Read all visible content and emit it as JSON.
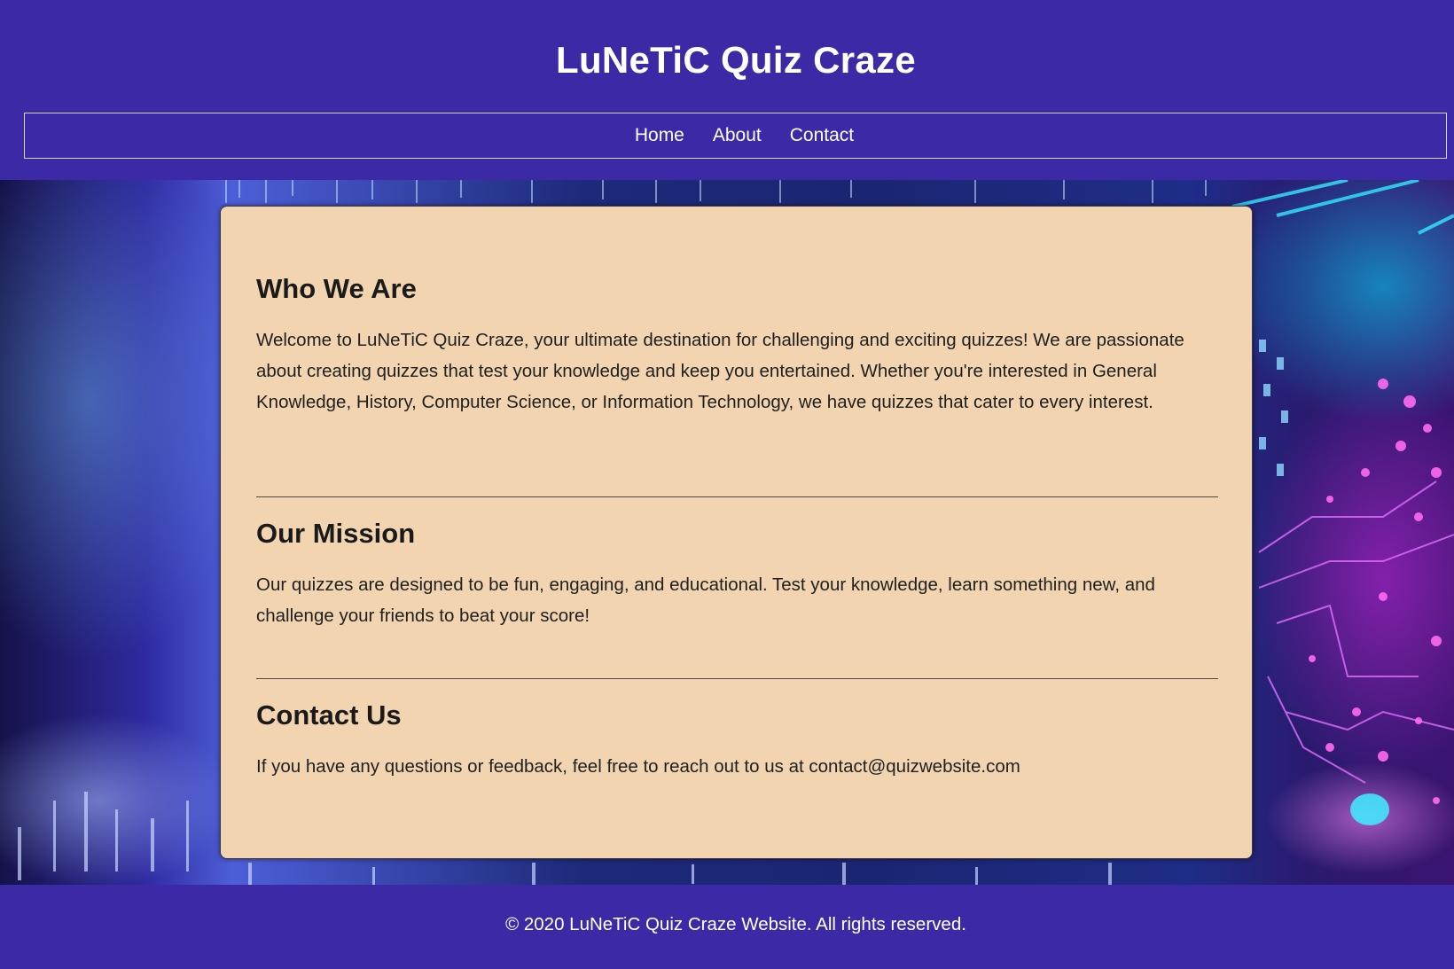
{
  "header": {
    "title": "LuNeTiC Quiz Craze",
    "nav": [
      {
        "label": "Home"
      },
      {
        "label": "About"
      },
      {
        "label": "Contact"
      }
    ]
  },
  "main": {
    "sections": [
      {
        "heading": "Who We Are",
        "body": "Welcome to LuNeTiC Quiz Craze, your ultimate destination for challenging and exciting quizzes! We are passionate about creating quizzes that test your knowledge and keep you entertained. Whether you're interested in General Knowledge, History, Computer Science, or Information Technology, we have quizzes that cater to every interest."
      },
      {
        "heading": "Our Mission",
        "body": "Our quizzes are designed to be fun, engaging, and educational. Test your knowledge, learn something new, and challenge your friends to beat your score!"
      },
      {
        "heading": "Contact Us",
        "body": "If you have any questions or feedback, feel free to reach out to us at contact@quizwebsite.com"
      }
    ]
  },
  "footer": {
    "text": "© 2020 LuNeTiC Quiz Craze Website. All rights reserved."
  },
  "colors": {
    "header_bg": "#3b29a6",
    "card_bg": "#f2d5b0",
    "text_light": "#ffffff",
    "text_dark": "#1a1a1a"
  }
}
